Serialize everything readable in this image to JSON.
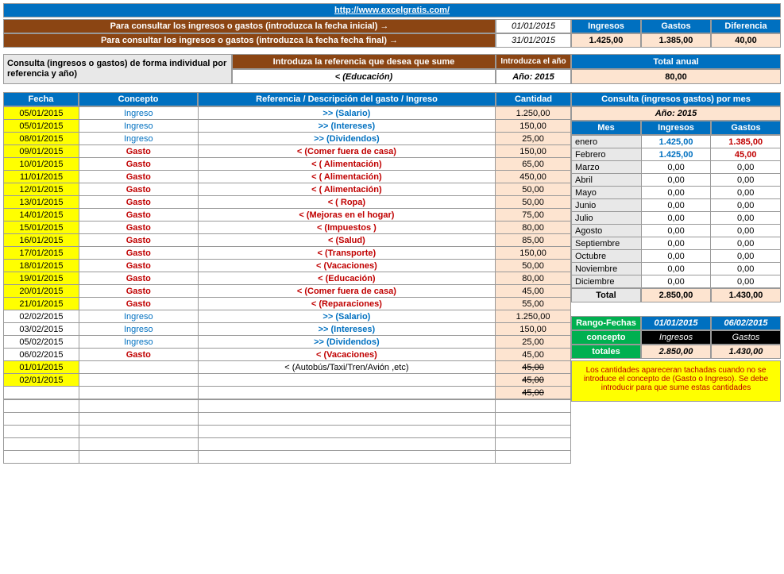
{
  "topUrl": "http://www.excelgratis.com/",
  "consultRow1": "Para consultar los ingresos o gastos (introduzca la fecha inicial) →",
  "consultRow2": "Para consultar los ingresos o gastos (introduzca la fecha fecha final) →",
  "dateStart": "01/01/2015",
  "dateEnd": "31/01/2015",
  "hdrIngresos": "Ingresos",
  "hdrGastos": "Gastos",
  "hdrDiferencia": "Diferencia",
  "valIngresos": "1.425,00",
  "valGastos": "1.385,00",
  "valDiferencia": "40,00",
  "consultaIndiv": "Consulta (ingresos o gastos) de forma individual  por referencia y año)",
  "introRef": "Introduza la referencia que desea que sume",
  "introAno": "Introduzca el año",
  "totalAnual": "Total anual",
  "refSelected": "<   (Educación)",
  "anoLabel": "Año:    2015",
  "totalAnualVal": "80,00",
  "col1": "Fecha",
  "col2": "Concepto",
  "col3": "Referencia / Descripción del gasto / Ingreso",
  "col4": "Cantidad",
  "col5": "Consulta (ingresos gastos) por mes",
  "monthYear": "Año:    2015",
  "mesHdr": "Mes",
  "ingresosHdr": "Ingresos",
  "gastosHdr": "Gastos",
  "entries": [
    {
      "fecha": "05/01/2015",
      "concepto": "Ingreso",
      "tipo": "I",
      "ref": ">>  (Salario)",
      "cant": "1.250,00"
    },
    {
      "fecha": "05/01/2015",
      "concepto": "Ingreso",
      "tipo": "I",
      "ref": ">>  (Intereses)",
      "cant": "150,00"
    },
    {
      "fecha": "08/01/2015",
      "concepto": "Ingreso",
      "tipo": "I",
      "ref": ">>  (Dividendos)",
      "cant": "25,00"
    },
    {
      "fecha": "09/01/2015",
      "concepto": "Gasto",
      "tipo": "G",
      "ref": "<  (Comer fuera de casa)",
      "cant": "150,00"
    },
    {
      "fecha": "10/01/2015",
      "concepto": "Gasto",
      "tipo": "G",
      "ref": "<  ( Alimentación)",
      "cant": "65,00"
    },
    {
      "fecha": "11/01/2015",
      "concepto": "Gasto",
      "tipo": "G",
      "ref": "<  ( Alimentación)",
      "cant": "450,00"
    },
    {
      "fecha": "12/01/2015",
      "concepto": "Gasto",
      "tipo": "G",
      "ref": "<  ( Alimentación)",
      "cant": "50,00"
    },
    {
      "fecha": "13/01/2015",
      "concepto": "Gasto",
      "tipo": "G",
      "ref": "<  ( Ropa)",
      "cant": "50,00"
    },
    {
      "fecha": "14/01/2015",
      "concepto": "Gasto",
      "tipo": "G",
      "ref": "<  (Mejoras en el hogar)",
      "cant": "75,00"
    },
    {
      "fecha": "15/01/2015",
      "concepto": "Gasto",
      "tipo": "G",
      "ref": "<  (Impuestos )",
      "cant": "80,00"
    },
    {
      "fecha": "16/01/2015",
      "concepto": "Gasto",
      "tipo": "G",
      "ref": "<  (Salud)",
      "cant": "85,00"
    },
    {
      "fecha": "17/01/2015",
      "concepto": "Gasto",
      "tipo": "G",
      "ref": "<  (Transporte)",
      "cant": "150,00"
    },
    {
      "fecha": "18/01/2015",
      "concepto": "Gasto",
      "tipo": "G",
      "ref": "<  (Vacaciones)",
      "cant": "50,00"
    },
    {
      "fecha": "19/01/2015",
      "concepto": "Gasto",
      "tipo": "G",
      "ref": "<  (Educación)",
      "cant": "80,00"
    },
    {
      "fecha": "20/01/2015",
      "concepto": "Gasto",
      "tipo": "G",
      "ref": "<  (Comer fuera de casa)",
      "cant": "45,00"
    },
    {
      "fecha": "21/01/2015",
      "concepto": "Gasto",
      "tipo": "G",
      "ref": "<  (Reparaciones)",
      "cant": "55,00"
    },
    {
      "fecha": "02/02/2015",
      "concepto": "Ingreso",
      "tipo": "I",
      "ref": ">>  (Salario)",
      "cant": "1.250,00",
      "feb": true
    },
    {
      "fecha": "03/02/2015",
      "concepto": "Ingreso",
      "tipo": "I",
      "ref": ">>  (Intereses)",
      "cant": "150,00",
      "feb": true
    },
    {
      "fecha": "05/02/2015",
      "concepto": "Ingreso",
      "tipo": "I",
      "ref": ">>  (Dividendos)",
      "cant": "25,00",
      "feb": true
    },
    {
      "fecha": "06/02/2015",
      "concepto": "Gasto",
      "tipo": "G",
      "ref": "<  (Vacaciones)",
      "cant": "45,00",
      "feb": true
    },
    {
      "fecha": "01/01/2015",
      "concepto": "",
      "tipo": "",
      "ref": "<  (Autobús/Taxi/Tren/Avión ,etc)",
      "cant": "45,00",
      "strike": true
    },
    {
      "fecha": "02/01/2015",
      "concepto": "",
      "tipo": "",
      "ref": "",
      "cant": "45,00",
      "strike": true
    },
    {
      "fecha": "",
      "concepto": "",
      "tipo": "",
      "ref": "",
      "cant": "45,00",
      "strike": true,
      "nofecha": true
    }
  ],
  "months": [
    {
      "m": "enero",
      "i": "1.425,00",
      "g": "1.385,00",
      "hl": true
    },
    {
      "m": "Febrero",
      "i": "1.425,00",
      "g": "45,00",
      "hl": true
    },
    {
      "m": "Marzo",
      "i": "0,00",
      "g": "0,00"
    },
    {
      "m": "Abril",
      "i": "0,00",
      "g": "0,00"
    },
    {
      "m": "Mayo",
      "i": "0,00",
      "g": "0,00"
    },
    {
      "m": "Junio",
      "i": "0,00",
      "g": "0,00"
    },
    {
      "m": "Julio",
      "i": "0,00",
      "g": "0,00"
    },
    {
      "m": "Agosto",
      "i": "0,00",
      "g": "0,00"
    },
    {
      "m": "Septiembre",
      "i": "0,00",
      "g": "0,00"
    },
    {
      "m": "Octubre",
      "i": "0,00",
      "g": "0,00"
    },
    {
      "m": "Noviembre",
      "i": "0,00",
      "g": "0,00"
    },
    {
      "m": "Diciembre",
      "i": "0,00",
      "g": "0,00"
    }
  ],
  "totalLabel": "Total",
  "totalI": "2.850,00",
  "totalG": "1.430,00",
  "rangoFechas": "Rango-Fechas",
  "rangoD1": "01/01/2015",
  "rangoD2": "06/02/2015",
  "conceptoLbl": "concepto",
  "conceptoI": "Ingresos",
  "conceptoG": "Gastos",
  "totalesLbl": "totales",
  "totalesI": "2.850,00",
  "totalesG": "1.430,00",
  "note": "Los cantidades apareceran tachadas cuando no se introduce el concepto de (Gasto o Ingreso).  Se debe introducir para que sume estas cantidades"
}
